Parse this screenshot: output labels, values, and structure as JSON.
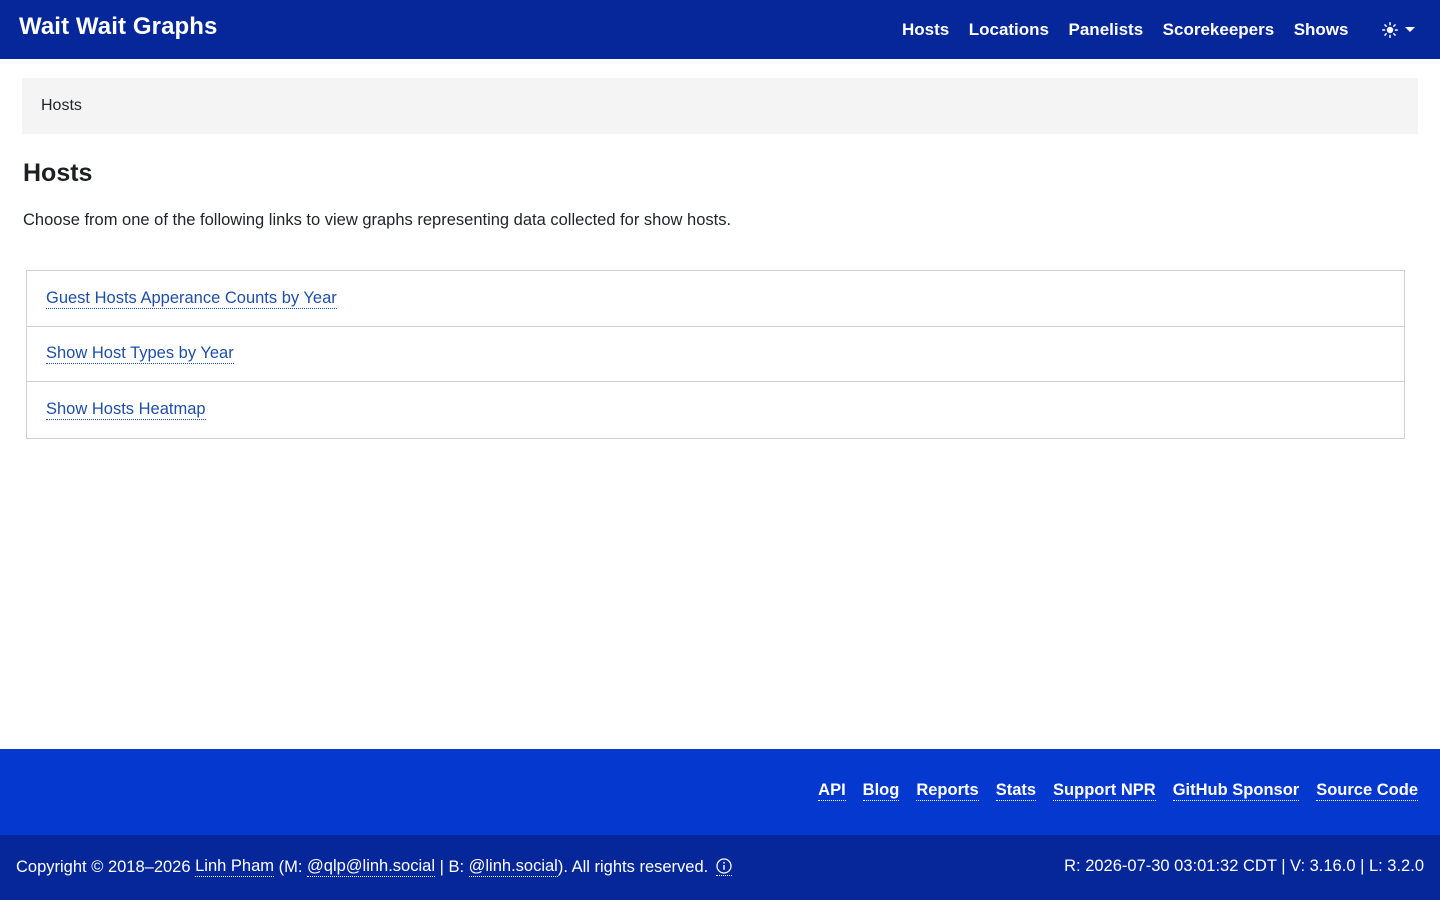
{
  "header": {
    "brand": "Wait Wait Graphs",
    "nav": [
      "Hosts",
      "Locations",
      "Panelists",
      "Scorekeepers",
      "Shows"
    ],
    "theme_icon": "sun-icon"
  },
  "breadcrumb": {
    "current": "Hosts"
  },
  "main": {
    "title": "Hosts",
    "intro": "Choose from one of the following links to view graphs representing data collected for show hosts.",
    "links": [
      "Guest Hosts Apperance Counts by Year",
      "Show Host Types by Year",
      "Show Hosts Heatmap"
    ]
  },
  "footer": {
    "links": [
      "API",
      "Blog",
      "Reports",
      "Stats",
      "Support NPR",
      "GitHub Sponsor",
      "Source Code"
    ],
    "copyright_prefix": "Copyright © 2018–2026 ",
    "author": "Linh Pham",
    "mastodon_prefix": " (M: ",
    "mastodon": "@qlp@linh.social",
    "bluesky_prefix": " | B: ",
    "bluesky": "@linh.social",
    "rights": "). All rights reserved.",
    "build": "R: 2026-07-30 03:01:32 CDT | V: 3.16.0 | L: 3.2.0"
  },
  "colors": {
    "nav_bg": "#05279a",
    "footer_top_bg": "#0538cf",
    "link": "#1f4ea8"
  }
}
